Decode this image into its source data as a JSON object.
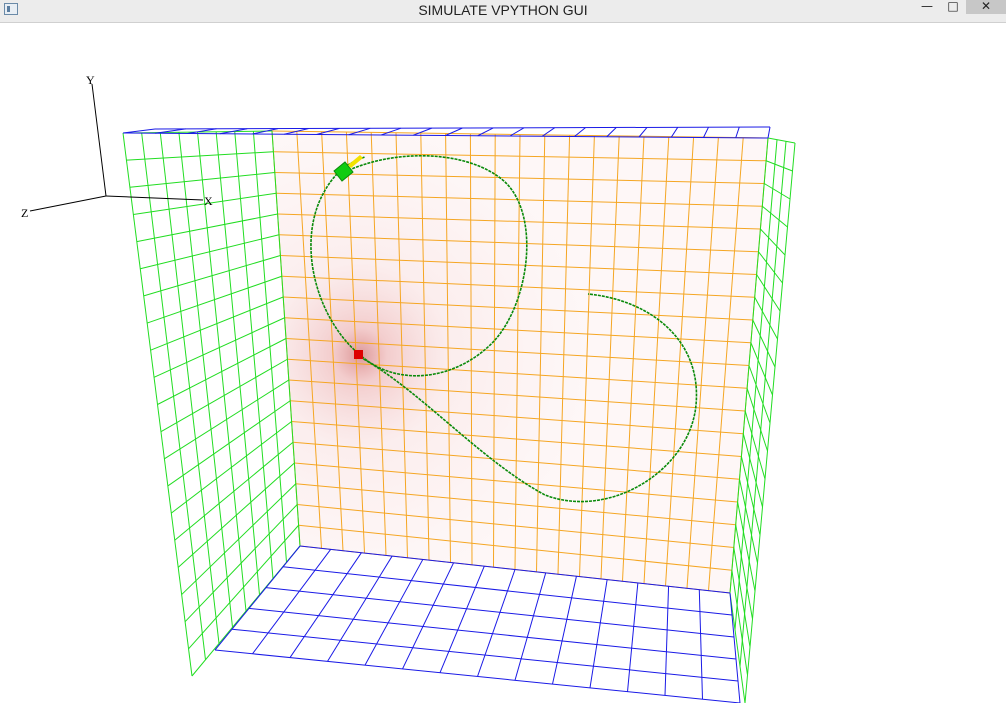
{
  "window": {
    "title": "SIMULATE VPYTHON GUI",
    "controls": {
      "minimize": "—",
      "maximize": "□",
      "close": "✕"
    }
  },
  "axes": {
    "x": "X",
    "y": "Y",
    "z": "Z"
  },
  "colors": {
    "back_grid": "#f5a623",
    "side_grid": "#22dd22",
    "floor_grid": "#1a1ae6",
    "trajectory": "#0a8a0a",
    "charge": "#dd0000",
    "particle": "#11cc11",
    "velocity_arrow": "#f2e200"
  },
  "icons": {
    "app": "app-window-icon",
    "minimize": "minimize-icon",
    "maximize": "maximize-icon",
    "close": "close-icon"
  }
}
